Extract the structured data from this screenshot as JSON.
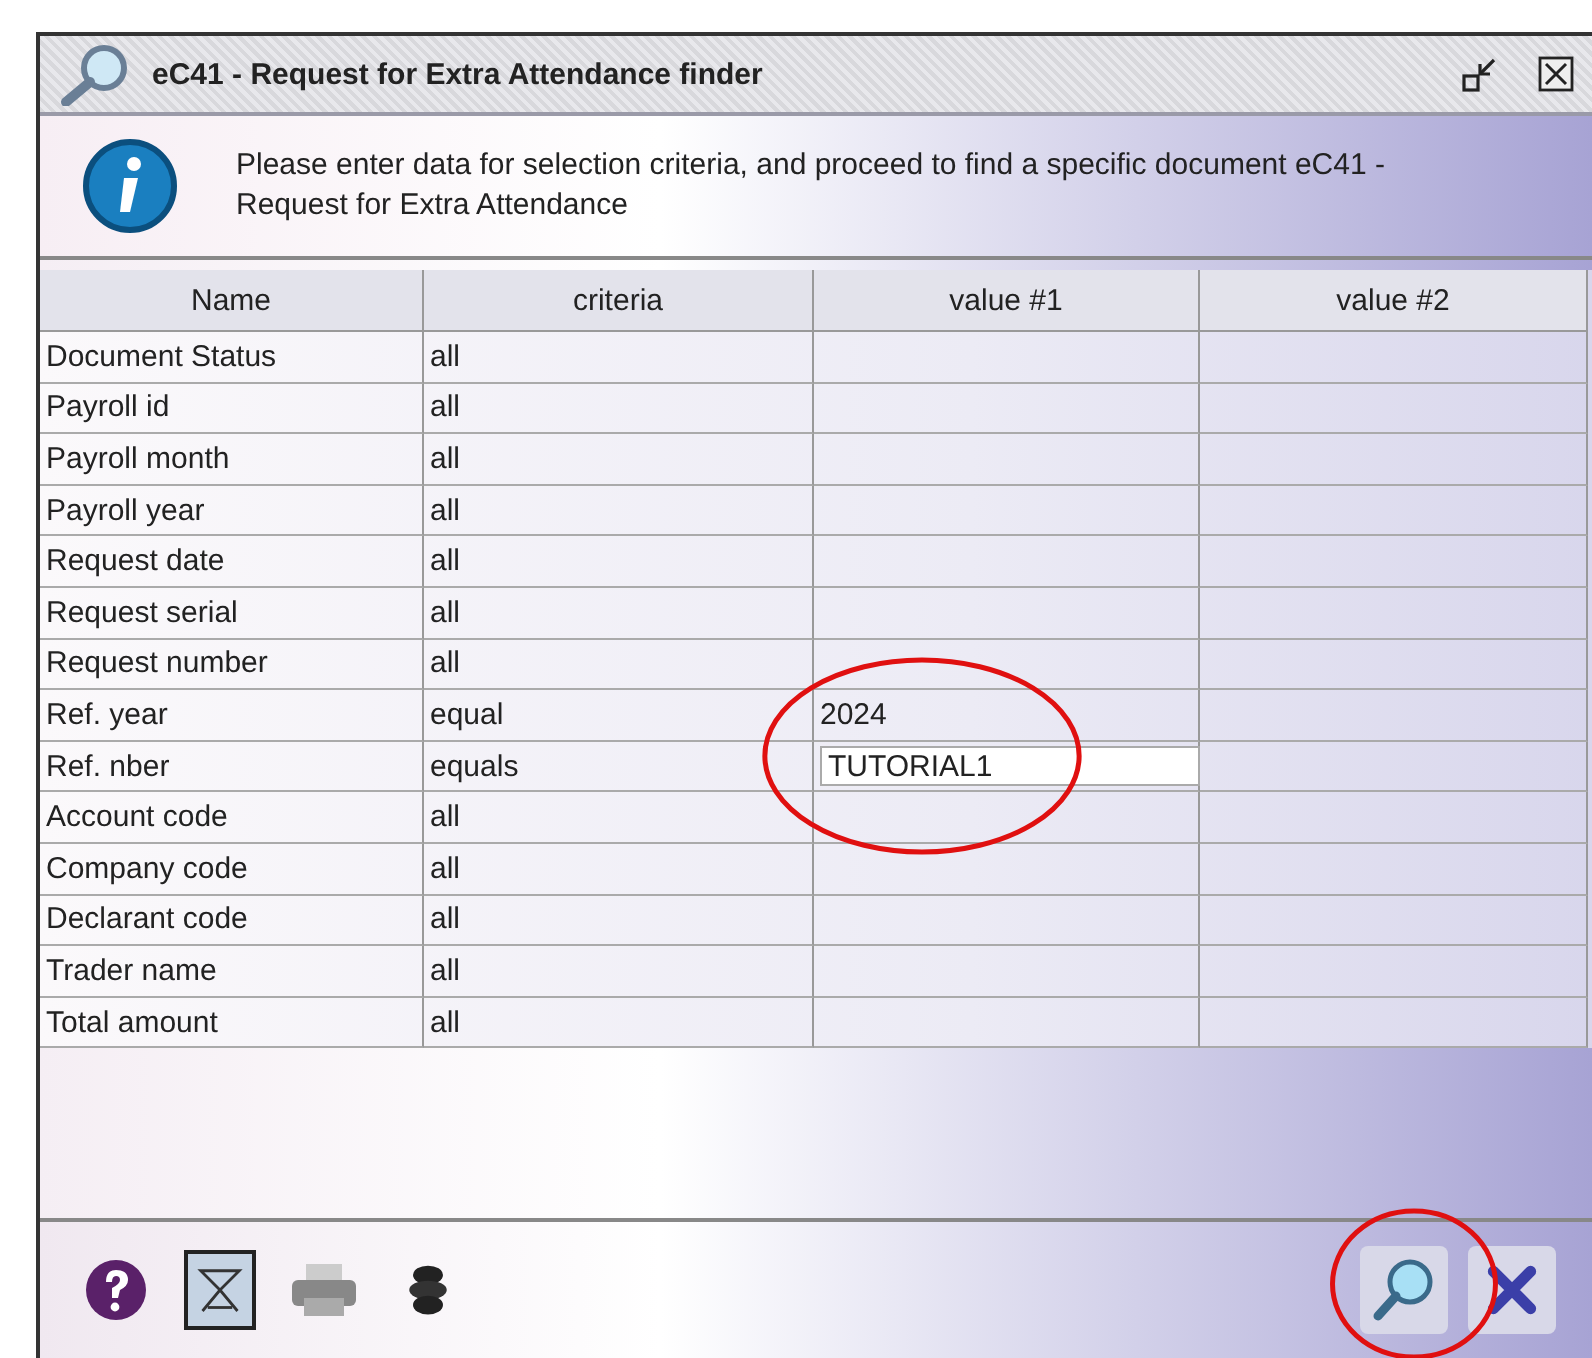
{
  "window": {
    "title": "eC41 - Request for Extra Attendance finder"
  },
  "info": {
    "message": "Please enter data for selection criteria, and proceed to find a specific document eC41 - Request for Extra Attendance"
  },
  "table": {
    "columns": [
      "Name",
      "criteria",
      "value #1",
      "value #2"
    ],
    "rows": [
      {
        "name": "Document Status",
        "criteria": "all",
        "value1": "",
        "editing": false
      },
      {
        "name": "Payroll id",
        "criteria": "all",
        "value1": "",
        "editing": false
      },
      {
        "name": "Payroll month",
        "criteria": "all",
        "value1": "",
        "editing": false
      },
      {
        "name": "Payroll year",
        "criteria": "all",
        "value1": "",
        "editing": false
      },
      {
        "name": "Request date",
        "criteria": "all",
        "value1": "",
        "editing": false
      },
      {
        "name": "Request serial",
        "criteria": "all",
        "value1": "",
        "editing": false
      },
      {
        "name": "Request number",
        "criteria": "all",
        "value1": "",
        "editing": false
      },
      {
        "name": "Ref. year",
        "criteria": "equal",
        "value1": "2024",
        "editing": false
      },
      {
        "name": "Ref. nber",
        "criteria": "equals",
        "value1": "TUTORIAL1",
        "editing": true
      },
      {
        "name": "Account code",
        "criteria": "all",
        "value1": "",
        "editing": false
      },
      {
        "name": "Company code",
        "criteria": "all",
        "value1": "",
        "editing": false
      },
      {
        "name": "Declarant code",
        "criteria": "all",
        "value1": "",
        "editing": false
      },
      {
        "name": "Trader name",
        "criteria": "all",
        "value1": "",
        "editing": false
      },
      {
        "name": "Total amount",
        "criteria": "all",
        "value1": "",
        "editing": false
      }
    ]
  },
  "toolbar": [
    {
      "kind": "help",
      "selected": false
    },
    {
      "kind": "filter",
      "selected": true
    },
    {
      "kind": "print",
      "selected": false
    },
    {
      "kind": "stack",
      "selected": false
    }
  ],
  "actions": [
    {
      "kind": "find"
    },
    {
      "kind": "cancel"
    }
  ],
  "annotations": [
    {
      "kind": "ellipse"
    },
    {
      "kind": "ellipse"
    }
  ]
}
